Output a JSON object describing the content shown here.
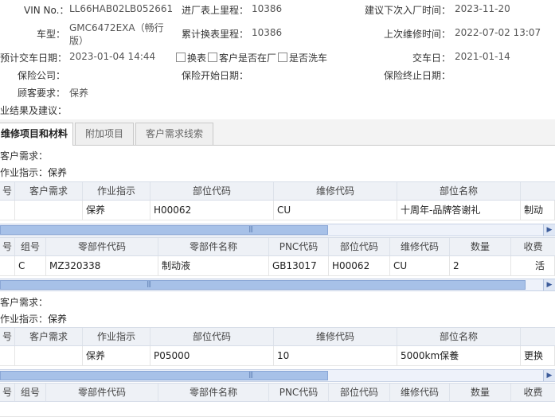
{
  "info": {
    "vin_label": "VIN No.：",
    "vin_value": "LL66HAB02LB052661",
    "mileage_in_label": "进厂表上里程：",
    "mileage_in_value": "10386",
    "next_visit_label": "建议下次入厂时间：",
    "next_visit_value": "2023-11-20",
    "model_label": "车型：",
    "model_value_1": "GMC6472EXA（畅行",
    "model_value_2": "版）",
    "cumulative_label": "累计换表里程：",
    "cumulative_value": "10386",
    "last_repair_label": "上次维修时间：",
    "last_repair_value": "2022-07-02 13:07",
    "est_delivery_label": "预计交车日期：",
    "est_delivery_value": "2023-01-04 14:44",
    "chk_change_meter": "换表",
    "chk_customer_present": "客户是否在厂",
    "chk_wash": "是否洗车",
    "delivery_label": "交车日：",
    "delivery_value": "2021-01-14",
    "insurer_label": "保险公司：",
    "ins_start_label": "保险开始日期：",
    "ins_end_label": "保险终止日期：",
    "customer_req_label": "顾客要求：",
    "customer_req_value": "保养",
    "result_label": "业结果及建议："
  },
  "tabs": [
    "维修项目和材料",
    "附加项目",
    "客户需求线索"
  ],
  "sections": [
    {
      "customer_need_label": "客户需求：",
      "instruction_label": "作业指示：",
      "instruction_value": "保养",
      "item_header": [
        "号",
        "客户需求",
        "作业指示",
        "部位代码",
        "维修代码",
        "部位名称"
      ],
      "item_row": [
        "",
        "",
        "保养",
        "H00062",
        "CU",
        "十周年-品牌答谢礼",
        "制动"
      ],
      "part_header": [
        "号",
        "组号",
        "零部件代码",
        "零部件名称",
        "PNC代码",
        "部位代码",
        "维修代码",
        "数量",
        "收费"
      ],
      "part_row": [
        "",
        "C",
        "MZ320338",
        "制动液",
        "GB13017",
        "H00062",
        "CU",
        "2",
        "活"
      ]
    },
    {
      "customer_need_label": "客户需求：",
      "instruction_label": "作业指示：",
      "instruction_value": "保养",
      "item_header": [
        "号",
        "客户需求",
        "作业指示",
        "部位代码",
        "维修代码",
        "部位名称"
      ],
      "item_row": [
        "",
        "",
        "保养",
        "P05000",
        "10",
        "5000km保養",
        "更换"
      ],
      "part_header": [
        "号",
        "组号",
        "零部件代码",
        "零部件名称",
        "PNC代码",
        "部位代码",
        "维修代码",
        "数量",
        "收费"
      ]
    }
  ]
}
